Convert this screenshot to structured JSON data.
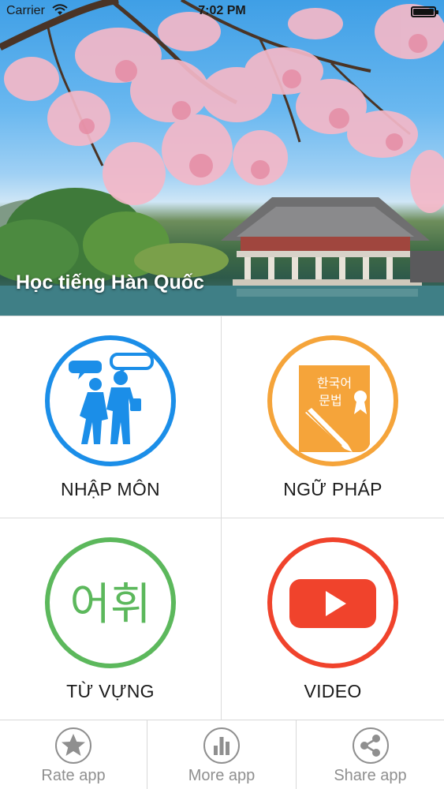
{
  "status_bar": {
    "carrier": "Carrier",
    "time": "7:02 PM"
  },
  "header": {
    "title": "Học tiếng Hàn Quốc"
  },
  "menu": {
    "items": [
      {
        "label": "NHẬP MÔN",
        "icon": "people-talking-icon",
        "color": "#1b8ee8"
      },
      {
        "label": "NGỮ PHÁP",
        "icon": "grammar-book-icon",
        "color": "#f5a43a",
        "icon_text_line1": "한국어",
        "icon_text_line2": "문법"
      },
      {
        "label": "TỪ VỰNG",
        "icon": "vocabulary-icon",
        "color": "#5cb85c",
        "icon_text": "어휘"
      },
      {
        "label": "VIDEO",
        "icon": "video-play-icon",
        "color": "#f0432c"
      }
    ]
  },
  "tabbar": {
    "items": [
      {
        "label": "Rate app",
        "icon": "star-icon"
      },
      {
        "label": "More app",
        "icon": "bar-chart-icon"
      },
      {
        "label": "Share app",
        "icon": "share-icon"
      }
    ],
    "icon_color": "#8f8f8f"
  }
}
